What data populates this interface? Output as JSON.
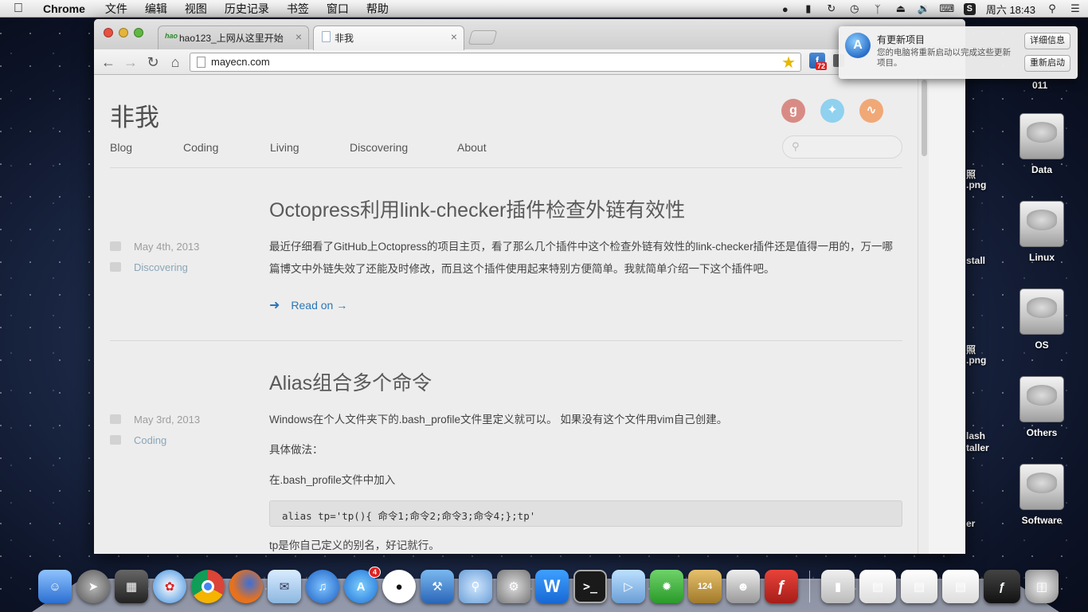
{
  "menubar": {
    "app_name": "Chrome",
    "items": [
      "文件",
      "编辑",
      "视图",
      "历史记录",
      "书签",
      "窗口",
      "帮助"
    ],
    "clock": "周六 18:43"
  },
  "browser": {
    "tabs": [
      {
        "title": "hao123_上网从这里开始",
        "favicon": "hao"
      },
      {
        "title": "非我"
      }
    ],
    "url": "mayecn.com",
    "extension_badge": "72"
  },
  "site": {
    "title": "非我",
    "nav": [
      "Blog",
      "Coding",
      "Living",
      "Discovering",
      "About"
    ],
    "posts": [
      {
        "title": "Octopress利用link-checker插件检查外链有效性",
        "date": "May 4th, 2013",
        "category": "Discovering",
        "excerpt": "最近仔细看了GitHub上Octopress的项目主页，看了那么几个插件中这个检查外链有效性的link-checker插件还是值得一用的，万一哪篇博文中外链失效了还能及时修改，而且这个插件使用起来特别方便简单。我就简单介绍一下这个插件吧。",
        "read_on": "Read on →"
      },
      {
        "title": "Alias组合多个命令",
        "date": "May 3rd, 2013",
        "category": "Coding",
        "p1": "Windows在个人文件夹下的.bash_profile文件里定义就可以。 如果没有这个文件用vim自己创建。",
        "p2": "具体做法：",
        "p3": "在.bash_profile文件中加入",
        "code": "alias tp='tp(){ 命令1;命令2;命令3;命令4;};tp'",
        "p4": "tp是你自己定义的别名，好记就行。"
      }
    ]
  },
  "notification": {
    "title": "有更新项目",
    "body": "您的电脑将重新启动以完成这些更新项目。",
    "btn_details": "详细信息",
    "btn_restart": "重新启动"
  },
  "desktop": {
    "drives": [
      "Data",
      "Linux",
      "OS",
      "Others",
      "Software"
    ],
    "partial_labels": [
      "011",
      "照",
      ".png",
      "stall",
      "照",
      ".png",
      "lash",
      "taller",
      "er"
    ]
  },
  "dock": {
    "badges": {
      "app_store": "4",
      "calendar": "124"
    }
  }
}
